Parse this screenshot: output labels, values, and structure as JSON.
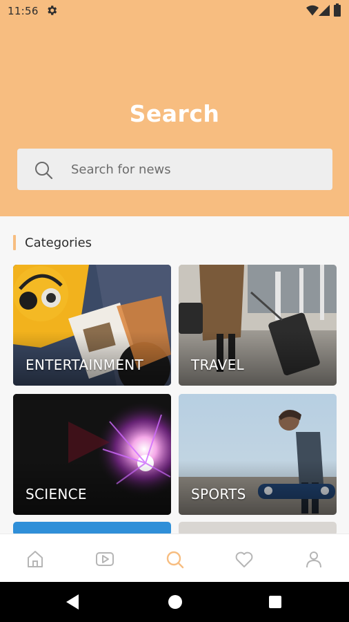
{
  "status_bar": {
    "time": "11:56",
    "icons": [
      "gear-icon",
      "wifi-icon",
      "signal-icon",
      "battery-icon"
    ]
  },
  "header": {
    "title": "Search",
    "background_color": "#f7bd80"
  },
  "search": {
    "placeholder": "Search for news",
    "value": ""
  },
  "categories": {
    "title": "Categories",
    "accent_color": "#f7bd80",
    "items": [
      {
        "label": "ENTERTAINMENT"
      },
      {
        "label": "TRAVEL"
      },
      {
        "label": "SCIENCE"
      },
      {
        "label": "SPORTS"
      }
    ]
  },
  "bottom_nav": {
    "items": [
      {
        "icon": "home-icon",
        "active": false
      },
      {
        "icon": "video-icon",
        "active": false
      },
      {
        "icon": "search-icon",
        "active": true
      },
      {
        "icon": "heart-icon",
        "active": false
      },
      {
        "icon": "profile-icon",
        "active": false
      }
    ],
    "active_color": "#f7bd80",
    "inactive_color": "#b5b5b5"
  },
  "system_nav": {
    "icons": [
      "back-icon",
      "home-circle-icon",
      "recents-icon"
    ]
  }
}
